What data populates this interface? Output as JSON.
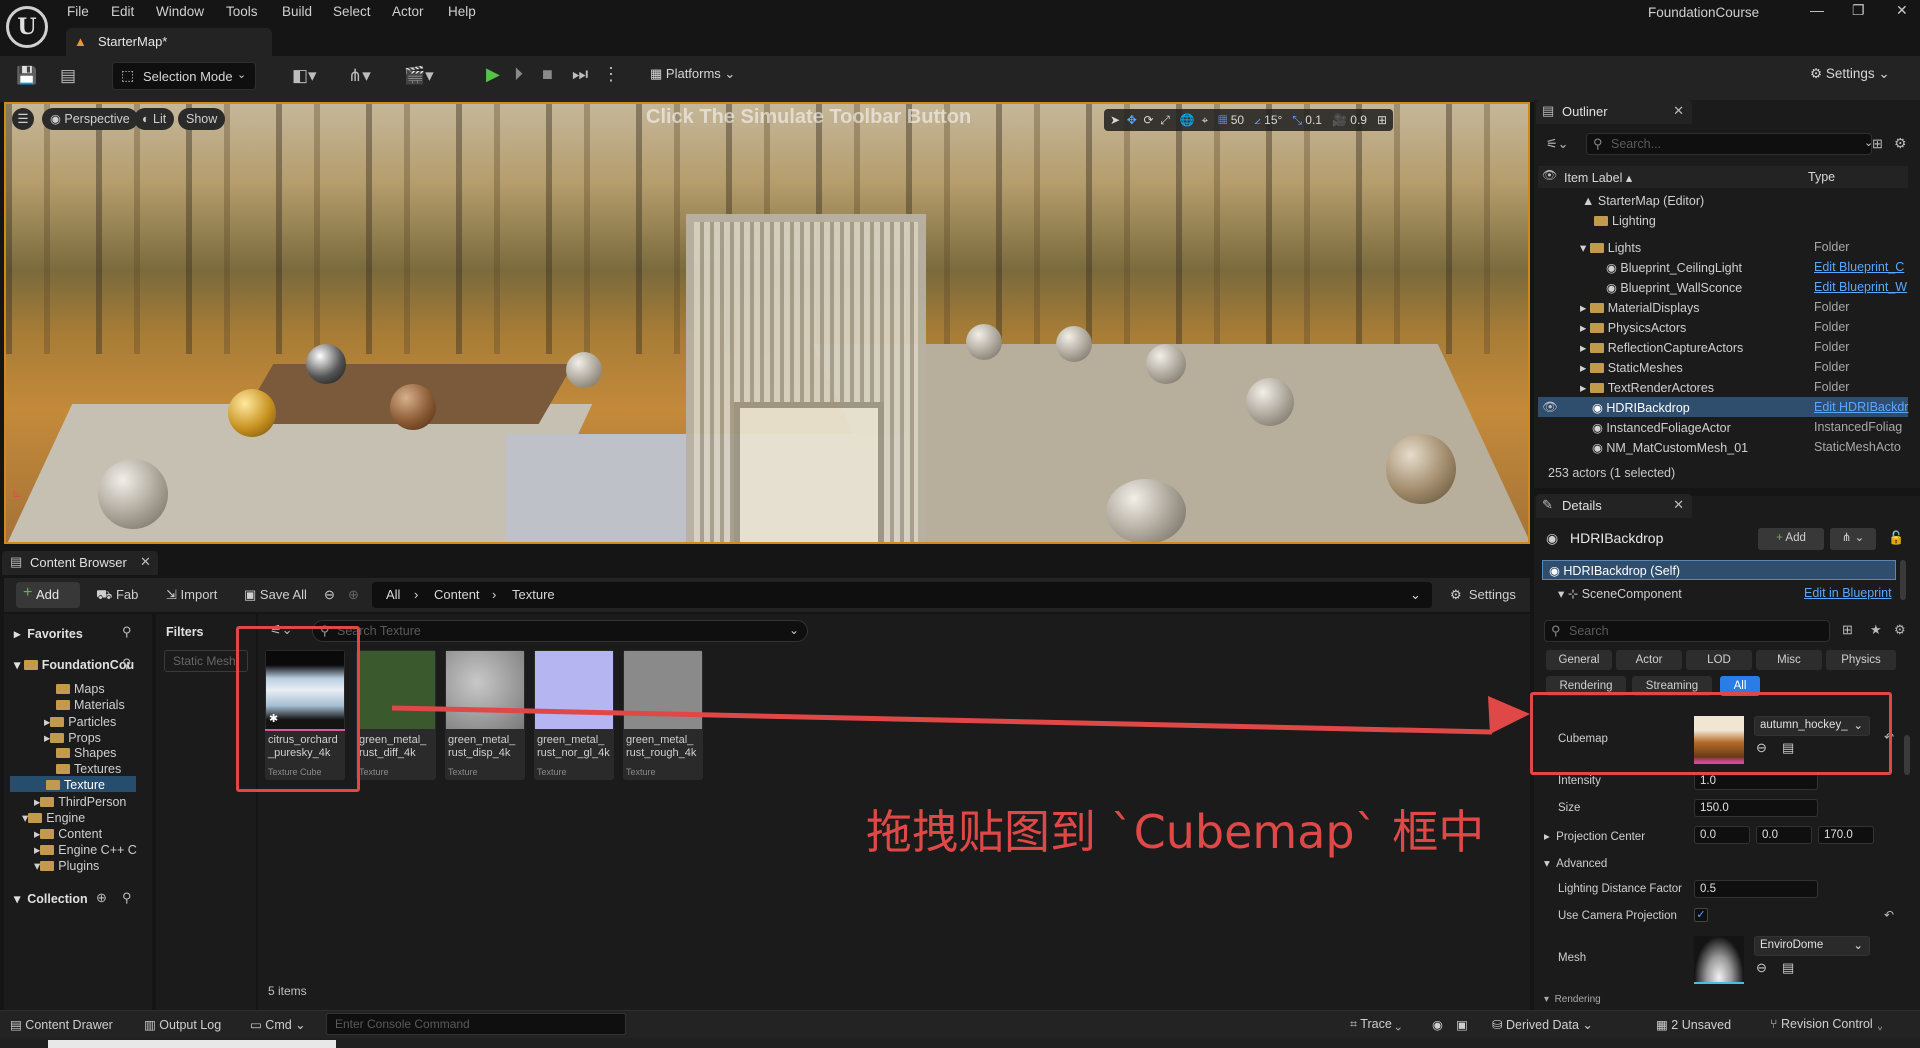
{
  "app": {
    "title": "FoundationCourse",
    "logo_text": "U",
    "document_tab": "StarterMap*"
  },
  "menu": [
    "File",
    "Edit",
    "Window",
    "Tools",
    "Build",
    "Select",
    "Actor",
    "Help"
  ],
  "toolbar": {
    "selection_mode": "Selection Mode",
    "platforms": "Platforms",
    "settings": "Settings"
  },
  "viewport": {
    "perspective": "Perspective",
    "lit": "Lit",
    "show": "Show",
    "hint": "Click The Simulate Toolbar Button",
    "grid_size": "50",
    "rotation_snap": "15°",
    "scale_snap": "0.1",
    "camera_speed": "0.9"
  },
  "content_browser": {
    "tab": "Content Browser",
    "add": "Add",
    "fab": "Fab",
    "import": "Import",
    "save_all": "Save All",
    "settings": "Settings",
    "path": [
      "All",
      "Content",
      "Texture"
    ],
    "favorites": "Favorites",
    "root": "FoundationCou",
    "tree": [
      "Maps",
      "Materials",
      "Particles",
      "Props",
      "Shapes",
      "Textures",
      "Texture",
      "ThirdPerson",
      "Engine",
      "Content",
      "Engine C++ C",
      "Plugins"
    ],
    "collection": "Collection",
    "filters_title": "Filters",
    "filter_chip": "Static Mesh",
    "search_placeholder": "Search Texture",
    "assets": [
      {
        "name": "citrus_orchard_puresky_4k",
        "name_l1": "citrus_orchard",
        "name_l2": "_puresky_4k",
        "type": "Texture Cube",
        "color": "#9fb4c8"
      },
      {
        "name_l1": "green_metal_",
        "name_l2": "rust_diff_4k",
        "type": "Texture",
        "color": "#3a5a2e"
      },
      {
        "name_l1": "green_metal_",
        "name_l2": "rust_disp_4k",
        "type": "Texture",
        "color": "#9a9a9a"
      },
      {
        "name_l1": "green_metal_",
        "name_l2": "rust_nor_gl_4k",
        "type": "Texture",
        "color": "#b5b5f2"
      },
      {
        "name_l1": "green_metal_",
        "name_l2": "rust_rough_4k",
        "type": "Texture",
        "color": "#8a8a8a"
      }
    ],
    "items_count": "5 items"
  },
  "annotation": "拖拽贴图到 `Cubemap` 框中",
  "outliner": {
    "tab": "Outliner",
    "search_placeholder": "Search...",
    "col_label": "Item Label",
    "col_type": "Type",
    "rows": [
      {
        "name": "StarterMap (Editor)",
        "type": ""
      },
      {
        "name": "Lighting",
        "type": ""
      },
      {
        "name": "Lights",
        "type": "Folder"
      },
      {
        "name": "Blueprint_CeilingLight",
        "type": "Edit Blueprint_C"
      },
      {
        "name": "Blueprint_WallSconce",
        "type": "Edit Blueprint_W"
      },
      {
        "name": "MaterialDisplays",
        "type": "Folder"
      },
      {
        "name": "PhysicsActors",
        "type": "Folder"
      },
      {
        "name": "ReflectionCaptureActors",
        "type": "Folder"
      },
      {
        "name": "StaticMeshes",
        "type": "Folder"
      },
      {
        "name": "TextRenderActores",
        "type": "Folder"
      },
      {
        "name": "HDRIBackdrop",
        "type": "Edit HDRIBackdr"
      },
      {
        "name": "InstancedFoliageActor",
        "type": "InstancedFoliag"
      },
      {
        "name": "NM_MatCustomMesh_01",
        "type": "StaticMeshActo"
      }
    ],
    "status": "253 actors (1 selected)"
  },
  "details": {
    "tab": "Details",
    "actor": "HDRIBackdrop",
    "add": "Add",
    "self": "HDRIBackdrop (Self)",
    "scene_component": "SceneComponent",
    "edit_in_blueprint": "Edit in Blueprint",
    "search_placeholder": "Search",
    "categories": [
      "General",
      "Actor",
      "LOD",
      "Misc",
      "Physics",
      "Rendering",
      "Streaming",
      "All"
    ],
    "cubemap_label": "Cubemap",
    "cubemap_value": "autumn_hockey_",
    "intensity_label": "Intensity",
    "intensity": "1.0",
    "size_label": "Size",
    "size": "150.0",
    "projection_center_label": "Projection Center",
    "projection_center": [
      "0.0",
      "0.0",
      "170.0"
    ],
    "advanced": "Advanced",
    "lighting_distance_factor_label": "Lighting Distance Factor",
    "lighting_distance_factor": "0.5",
    "use_camera_projection_label": "Use Camera Projection",
    "mesh_label": "Mesh",
    "mesh_value": "EnviroDome",
    "rendering": "Rendering"
  },
  "statusbar": {
    "content_drawer": "Content Drawer",
    "output_log": "Output Log",
    "cmd": "Cmd",
    "console_placeholder": "Enter Console Command",
    "trace": "Trace",
    "derived_data": "Derived Data",
    "unsaved": "2 Unsaved",
    "revision_control": "Revision Control"
  },
  "colors": {
    "accent": "#d08a1a",
    "annotation": "#e04848",
    "selection": "#2f4e6e",
    "link": "#5aa7ff"
  }
}
